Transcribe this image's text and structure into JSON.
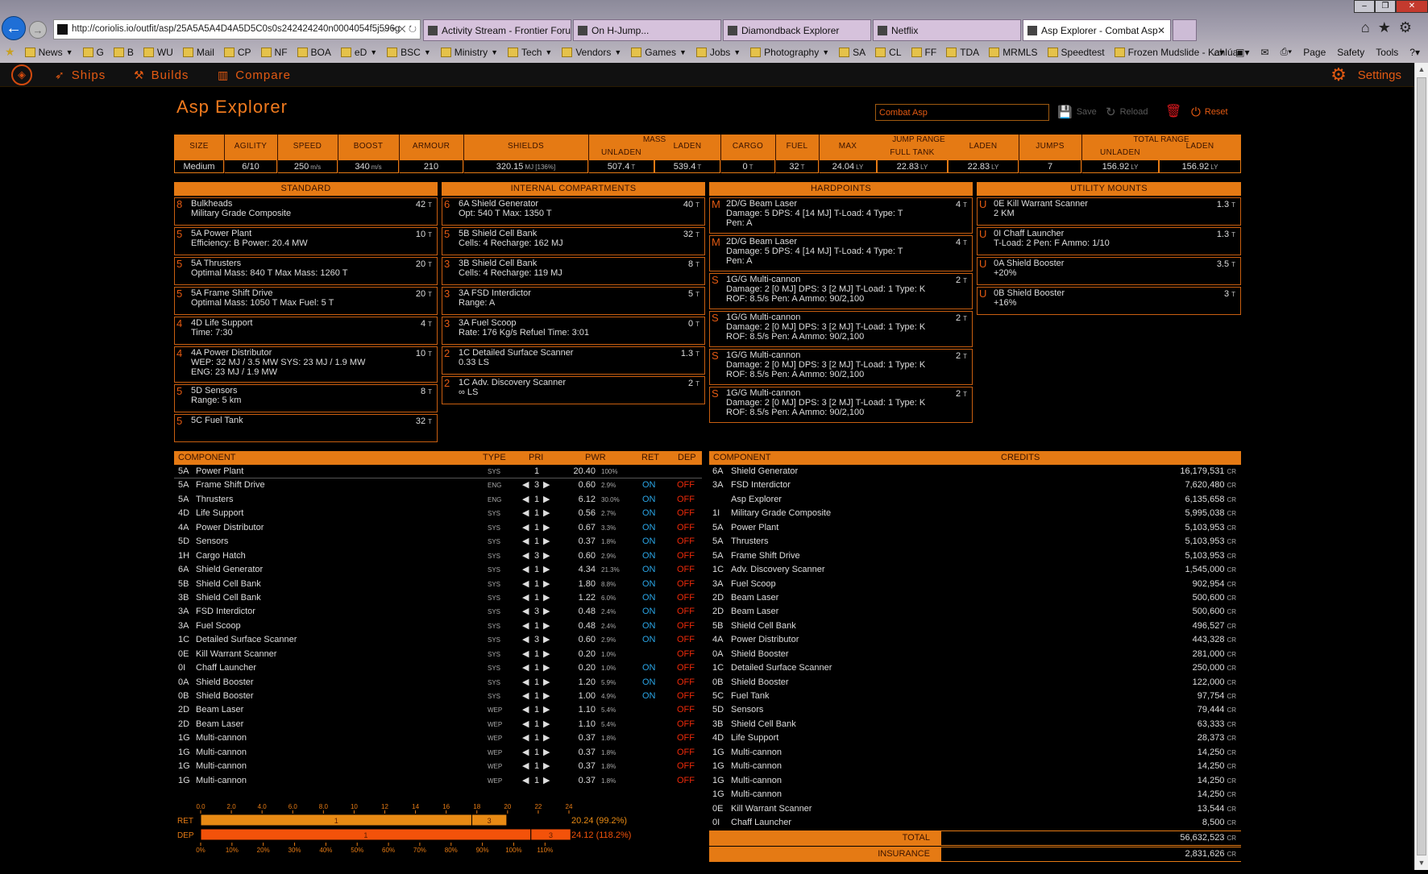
{
  "browser": {
    "url": "http://coriolis.io/outfit/asp/25A5A5A4D4A5D5C0s0s242424240n0004054f5j596g",
    "tabs": [
      {
        "title": "Activity Stream - Frontier Foru..."
      },
      {
        "title": "On H-Jump..."
      },
      {
        "title": "Diamondback Explorer"
      },
      {
        "title": "Netflix"
      },
      {
        "title": "Asp Explorer - Combat Asp",
        "active": true
      }
    ],
    "favorites": [
      {
        "label": "News",
        "dropdown": true
      },
      {
        "label": "G"
      },
      {
        "label": "B"
      },
      {
        "label": "WU"
      },
      {
        "label": "Mail"
      },
      {
        "label": "CP"
      },
      {
        "label": "NF"
      },
      {
        "label": "BOA"
      },
      {
        "label": "eD",
        "dropdown": true
      },
      {
        "label": "BSC",
        "dropdown": true
      },
      {
        "label": "Ministry",
        "dropdown": true
      },
      {
        "label": "Tech",
        "dropdown": true
      },
      {
        "label": "Vendors",
        "dropdown": true
      },
      {
        "label": "Games",
        "dropdown": true
      },
      {
        "label": "Jobs",
        "dropdown": true
      },
      {
        "label": "Photography",
        "dropdown": true
      },
      {
        "label": "SA"
      },
      {
        "label": "CL"
      },
      {
        "label": "FF"
      },
      {
        "label": "TDA"
      },
      {
        "label": "MRMLS"
      },
      {
        "label": "Speedtest"
      },
      {
        "label": "Frozen Mudslide - Kahlúa"
      }
    ],
    "menus": [
      "Page",
      "Safety",
      "Tools"
    ]
  },
  "nav": {
    "ships": "Ships",
    "builds": "Builds",
    "compare": "Compare",
    "settings": "Settings"
  },
  "header": {
    "title": "Asp Explorer",
    "build_name": "Combat Asp",
    "save": "Save",
    "reload": "Reload",
    "reset": "Reset"
  },
  "stats": {
    "size": {
      "label": "SIZE",
      "value": "Medium"
    },
    "agility": {
      "label": "AGILITY",
      "value": "6/10"
    },
    "speed": {
      "label": "SPEED",
      "value": "250",
      "unit": "m/s"
    },
    "boost": {
      "label": "BOOST",
      "value": "340",
      "unit": "m/s"
    },
    "armour": {
      "label": "ARMOUR",
      "value": "210"
    },
    "shields": {
      "label": "SHIELDS",
      "value": "320.15",
      "unit": "MJ [136%]"
    },
    "mass": {
      "label": "MASS",
      "unladen_label": "UNLADEN",
      "laden_label": "LADEN",
      "unladen": "507.4",
      "laden": "539.4",
      "unit": "T"
    },
    "cargo": {
      "label": "CARGO",
      "value": "0",
      "unit": "T"
    },
    "fuel": {
      "label": "FUEL",
      "value": "32",
      "unit": "T"
    },
    "jump": {
      "label": "JUMP RANGE",
      "max_label": "MAX",
      "full_label": "FULL TANK",
      "laden_label": "LADEN",
      "max": "24.04",
      "full": "22.83",
      "laden": "22.83",
      "unit": "LY"
    },
    "total": {
      "label": "TOTAL RANGE",
      "jumps_label": "JUMPS",
      "unladen_label": "UNLADEN",
      "laden_label": "LADEN",
      "jumps": "7",
      "unladen": "156.92",
      "laden": "156.92",
      "unit": "LY"
    }
  },
  "standard": {
    "title": "STANDARD",
    "slots": [
      {
        "cls": "8",
        "lines": [
          "Bulkheads",
          "Military Grade Composite"
        ],
        "mass": "42",
        "unit": "T"
      },
      {
        "cls": "5",
        "lines": [
          "5A Power Plant",
          "Efficiency: B   Power: 20.4 MW"
        ],
        "mass": "10",
        "unit": "T"
      },
      {
        "cls": "5",
        "lines": [
          "5A Thrusters",
          "Optimal Mass: 840 T   Max Mass: 1260 T"
        ],
        "mass": "20",
        "unit": "T"
      },
      {
        "cls": "5",
        "lines": [
          "5A Frame Shift Drive",
          "Optimal Mass: 1050 T   Max Fuel: 5 T"
        ],
        "mass": "20",
        "unit": "T"
      },
      {
        "cls": "4",
        "lines": [
          "4D Life Support",
          "Time: 7:30"
        ],
        "mass": "4",
        "unit": "T"
      },
      {
        "cls": "4",
        "lines": [
          "4A Power Distributor",
          "WEP: 32 MJ / 3.5 MW   SYS: 23 MJ / 1.9 MW",
          "ENG: 23 MJ / 1.9 MW"
        ],
        "mass": "10",
        "unit": "T"
      },
      {
        "cls": "5",
        "lines": [
          "5D Sensors",
          "Range: 5 km"
        ],
        "mass": "8",
        "unit": "T"
      },
      {
        "cls": "5",
        "lines": [
          "5C Fuel Tank",
          ""
        ],
        "mass": "32",
        "unit": "T"
      }
    ]
  },
  "internal": {
    "title": "INTERNAL COMPARTMENTS",
    "slots": [
      {
        "cls": "6",
        "lines": [
          "6A Shield Generator",
          "Opt: 540 T   Max: 1350 T"
        ],
        "mass": "40",
        "unit": "T"
      },
      {
        "cls": "5",
        "lines": [
          "5B Shield Cell Bank",
          "Cells: 4   Recharge: 162 MJ"
        ],
        "mass": "32",
        "unit": "T"
      },
      {
        "cls": "3",
        "lines": [
          "3B Shield Cell Bank",
          "Cells: 4   Recharge: 119 MJ"
        ],
        "mass": "8",
        "unit": "T"
      },
      {
        "cls": "3",
        "lines": [
          "3A FSD Interdictor",
          "Range: A"
        ],
        "mass": "5",
        "unit": "T"
      },
      {
        "cls": "3",
        "lines": [
          "3A Fuel Scoop",
          "Rate: 176 Kg/s   Refuel Time: 3:01"
        ],
        "mass": "0",
        "unit": "T"
      },
      {
        "cls": "2",
        "lines": [
          "1C Detailed Surface Scanner",
          "0.33 LS"
        ],
        "mass": "1.3",
        "unit": "T"
      },
      {
        "cls": "2",
        "lines": [
          "1C Adv. Discovery Scanner",
          "∞ LS"
        ],
        "mass": "2",
        "unit": "T"
      }
    ]
  },
  "hardpoints": {
    "title": "HARDPOINTS",
    "slots": [
      {
        "cls": "M",
        "lines": [
          "2D/G Beam Laser",
          "Damage: 5   DPS: 4 [14 MJ]   T-Load: 4   Type: T",
          "Pen: A"
        ],
        "mass": "4",
        "unit": "T"
      },
      {
        "cls": "M",
        "lines": [
          "2D/G Beam Laser",
          "Damage: 5   DPS: 4 [14 MJ]   T-Load: 4   Type: T",
          "Pen: A"
        ],
        "mass": "4",
        "unit": "T"
      },
      {
        "cls": "S",
        "lines": [
          "1G/G Multi-cannon",
          "Damage: 2 [0 MJ]   DPS: 3 [2 MJ]   T-Load: 1   Type: K",
          "ROF: 8.5/s   Pen: A   Ammo: 90/2,100"
        ],
        "mass": "2",
        "unit": "T"
      },
      {
        "cls": "S",
        "lines": [
          "1G/G Multi-cannon",
          "Damage: 2 [0 MJ]   DPS: 3 [2 MJ]   T-Load: 1   Type: K",
          "ROF: 8.5/s   Pen: A   Ammo: 90/2,100"
        ],
        "mass": "2",
        "unit": "T"
      },
      {
        "cls": "S",
        "lines": [
          "1G/G Multi-cannon",
          "Damage: 2 [0 MJ]   DPS: 3 [2 MJ]   T-Load: 1   Type: K",
          "ROF: 8.5/s   Pen: A   Ammo: 90/2,100"
        ],
        "mass": "2",
        "unit": "T"
      },
      {
        "cls": "S",
        "lines": [
          "1G/G Multi-cannon",
          "Damage: 2 [0 MJ]   DPS: 3 [2 MJ]   T-Load: 1   Type: K",
          "ROF: 8.5/s   Pen: A   Ammo: 90/2,100"
        ],
        "mass": "2",
        "unit": "T"
      }
    ]
  },
  "utility": {
    "title": "UTILITY MOUNTS",
    "slots": [
      {
        "cls": "U",
        "lines": [
          "0E Kill Warrant Scanner",
          "2 KM"
        ],
        "mass": "1.3",
        "unit": "T"
      },
      {
        "cls": "U",
        "lines": [
          "0I Chaff Launcher",
          "T-Load: 2   Pen: F   Ammo: 1/10"
        ],
        "mass": "1.3",
        "unit": "T"
      },
      {
        "cls": "U",
        "lines": [
          "0A Shield Booster",
          "+20%"
        ],
        "mass": "3.5",
        "unit": "T"
      },
      {
        "cls": "U",
        "lines": [
          "0B Shield Booster",
          "+16%"
        ],
        "mass": "3",
        "unit": "T"
      }
    ]
  },
  "power": {
    "headers": {
      "component": "COMPONENT",
      "type": "TYPE",
      "pri": "PRI",
      "pwr": "PWR",
      "ret": "RET",
      "dep": "DEP"
    },
    "rows": [
      {
        "c": "5A",
        "name": "Power Plant",
        "type": "SYS",
        "pri": "1",
        "pwr": "20.40",
        "pct": "100%",
        "ret": "",
        "dep": "",
        "first": true
      },
      {
        "c": "5A",
        "name": "Frame Shift Drive",
        "type": "ENG",
        "pri": "3",
        "pwr": "0.60",
        "pct": "2.9%",
        "ret": "ON",
        "dep": "OFF"
      },
      {
        "c": "5A",
        "name": "Thrusters",
        "type": "ENG",
        "pri": "1",
        "pwr": "6.12",
        "pct": "30.0%",
        "ret": "ON",
        "dep": "OFF"
      },
      {
        "c": "4D",
        "name": "Life Support",
        "type": "SYS",
        "pri": "1",
        "pwr": "0.56",
        "pct": "2.7%",
        "ret": "ON",
        "dep": "OFF"
      },
      {
        "c": "4A",
        "name": "Power Distributor",
        "type": "SYS",
        "pri": "1",
        "pwr": "0.67",
        "pct": "3.3%",
        "ret": "ON",
        "dep": "OFF"
      },
      {
        "c": "5D",
        "name": "Sensors",
        "type": "SYS",
        "pri": "1",
        "pwr": "0.37",
        "pct": "1.8%",
        "ret": "ON",
        "dep": "OFF"
      },
      {
        "c": "1H",
        "name": "Cargo Hatch",
        "type": "SYS",
        "pri": "3",
        "pwr": "0.60",
        "pct": "2.9%",
        "ret": "ON",
        "dep": "OFF"
      },
      {
        "c": "6A",
        "name": "Shield Generator",
        "type": "SYS",
        "pri": "1",
        "pwr": "4.34",
        "pct": "21.3%",
        "ret": "ON",
        "dep": "OFF"
      },
      {
        "c": "5B",
        "name": "Shield Cell Bank",
        "type": "SYS",
        "pri": "1",
        "pwr": "1.80",
        "pct": "8.8%",
        "ret": "ON",
        "dep": "OFF"
      },
      {
        "c": "3B",
        "name": "Shield Cell Bank",
        "type": "SYS",
        "pri": "1",
        "pwr": "1.22",
        "pct": "6.0%",
        "ret": "ON",
        "dep": "OFF"
      },
      {
        "c": "3A",
        "name": "FSD Interdictor",
        "type": "SYS",
        "pri": "3",
        "pwr": "0.48",
        "pct": "2.4%",
        "ret": "ON",
        "dep": "OFF"
      },
      {
        "c": "3A",
        "name": "Fuel Scoop",
        "type": "SYS",
        "pri": "1",
        "pwr": "0.48",
        "pct": "2.4%",
        "ret": "ON",
        "dep": "OFF"
      },
      {
        "c": "1C",
        "name": "Detailed Surface Scanner",
        "type": "SYS",
        "pri": "3",
        "pwr": "0.60",
        "pct": "2.9%",
        "ret": "ON",
        "dep": "OFF"
      },
      {
        "c": "0E",
        "name": "Kill Warrant Scanner",
        "type": "SYS",
        "pri": "1",
        "pwr": "0.20",
        "pct": "1.0%",
        "ret": "",
        "dep": "OFF"
      },
      {
        "c": "0I",
        "name": "Chaff Launcher",
        "type": "SYS",
        "pri": "1",
        "pwr": "0.20",
        "pct": "1.0%",
        "ret": "ON",
        "dep": "OFF"
      },
      {
        "c": "0A",
        "name": "Shield Booster",
        "type": "SYS",
        "pri": "1",
        "pwr": "1.20",
        "pct": "5.9%",
        "ret": "ON",
        "dep": "OFF"
      },
      {
        "c": "0B",
        "name": "Shield Booster",
        "type": "SYS",
        "pri": "1",
        "pwr": "1.00",
        "pct": "4.9%",
        "ret": "ON",
        "dep": "OFF"
      },
      {
        "c": "2D",
        "name": "Beam Laser",
        "type": "WEP",
        "pri": "1",
        "pwr": "1.10",
        "pct": "5.4%",
        "ret": "",
        "dep": "OFF"
      },
      {
        "c": "2D",
        "name": "Beam Laser",
        "type": "WEP",
        "pri": "1",
        "pwr": "1.10",
        "pct": "5.4%",
        "ret": "",
        "dep": "OFF"
      },
      {
        "c": "1G",
        "name": "Multi-cannon",
        "type": "WEP",
        "pri": "1",
        "pwr": "0.37",
        "pct": "1.8%",
        "ret": "",
        "dep": "OFF"
      },
      {
        "c": "1G",
        "name": "Multi-cannon",
        "type": "WEP",
        "pri": "1",
        "pwr": "0.37",
        "pct": "1.8%",
        "ret": "",
        "dep": "OFF"
      },
      {
        "c": "1G",
        "name": "Multi-cannon",
        "type": "WEP",
        "pri": "1",
        "pwr": "0.37",
        "pct": "1.8%",
        "ret": "",
        "dep": "OFF"
      },
      {
        "c": "1G",
        "name": "Multi-cannon",
        "type": "WEP",
        "pri": "1",
        "pwr": "0.37",
        "pct": "1.8%",
        "ret": "",
        "dep": "OFF"
      }
    ]
  },
  "power_chart": {
    "mw_ticks": [
      "0.0",
      "2.0",
      "4.0",
      "6.0",
      "8.0",
      "10",
      "12",
      "14",
      "16",
      "18",
      "20",
      "22",
      "24"
    ],
    "pct_ticks": [
      "0%",
      "10%",
      "20%",
      "30%",
      "40%",
      "50%",
      "60%",
      "70%",
      "80%",
      "90%",
      "100%",
      "110%"
    ],
    "ret": {
      "label": "RET",
      "value": "20.24 (99.2%)",
      "segments": [
        {
          "pri": "1",
          "mw": 17.67
        },
        {
          "pri": "3",
          "mw": 2.28
        }
      ]
    },
    "dep": {
      "label": "DEP",
      "value": "24.12 (118.2%)",
      "segments": [
        {
          "pri": "1",
          "mw": 21.52
        },
        {
          "pri": "3",
          "mw": 2.6
        }
      ]
    },
    "mw_max": 24.0,
    "pct_max": 110,
    "colors": {
      "ret": "#e88a14",
      "dep": "#f3520a"
    }
  },
  "costs": {
    "headers": {
      "component": "COMPONENT",
      "credits": "CREDITS"
    },
    "unit": "CR",
    "rows": [
      {
        "c": "6A",
        "name": "Shield Generator",
        "value": "16,179,531"
      },
      {
        "c": "3A",
        "name": "FSD Interdictor",
        "value": "7,620,480"
      },
      {
        "c": "",
        "name": "Asp Explorer",
        "value": "6,135,658"
      },
      {
        "c": "1I",
        "name": "Military Grade Composite",
        "value": "5,995,038"
      },
      {
        "c": "5A",
        "name": "Power Plant",
        "value": "5,103,953"
      },
      {
        "c": "5A",
        "name": "Thrusters",
        "value": "5,103,953"
      },
      {
        "c": "5A",
        "name": "Frame Shift Drive",
        "value": "5,103,953"
      },
      {
        "c": "1C",
        "name": "Adv. Discovery Scanner",
        "value": "1,545,000"
      },
      {
        "c": "3A",
        "name": "Fuel Scoop",
        "value": "902,954"
      },
      {
        "c": "2D",
        "name": "Beam Laser",
        "value": "500,600"
      },
      {
        "c": "2D",
        "name": "Beam Laser",
        "value": "500,600"
      },
      {
        "c": "5B",
        "name": "Shield Cell Bank",
        "value": "496,527"
      },
      {
        "c": "4A",
        "name": "Power Distributor",
        "value": "443,328"
      },
      {
        "c": "0A",
        "name": "Shield Booster",
        "value": "281,000"
      },
      {
        "c": "1C",
        "name": "Detailed Surface Scanner",
        "value": "250,000"
      },
      {
        "c": "0B",
        "name": "Shield Booster",
        "value": "122,000"
      },
      {
        "c": "5C",
        "name": "Fuel Tank",
        "value": "97,754"
      },
      {
        "c": "5D",
        "name": "Sensors",
        "value": "79,444"
      },
      {
        "c": "3B",
        "name": "Shield Cell Bank",
        "value": "63,333"
      },
      {
        "c": "4D",
        "name": "Life Support",
        "value": "28,373"
      },
      {
        "c": "1G",
        "name": "Multi-cannon",
        "value": "14,250"
      },
      {
        "c": "1G",
        "name": "Multi-cannon",
        "value": "14,250"
      },
      {
        "c": "1G",
        "name": "Multi-cannon",
        "value": "14,250"
      },
      {
        "c": "1G",
        "name": "Multi-cannon",
        "value": "14,250"
      },
      {
        "c": "0E",
        "name": "Kill Warrant Scanner",
        "value": "13,544"
      },
      {
        "c": "0I",
        "name": "Chaff Launcher",
        "value": "8,500"
      }
    ],
    "total": {
      "label": "TOTAL",
      "value": "56,632,523"
    },
    "insurance": {
      "label": "INSURANCE",
      "value": "2,831,626"
    }
  }
}
